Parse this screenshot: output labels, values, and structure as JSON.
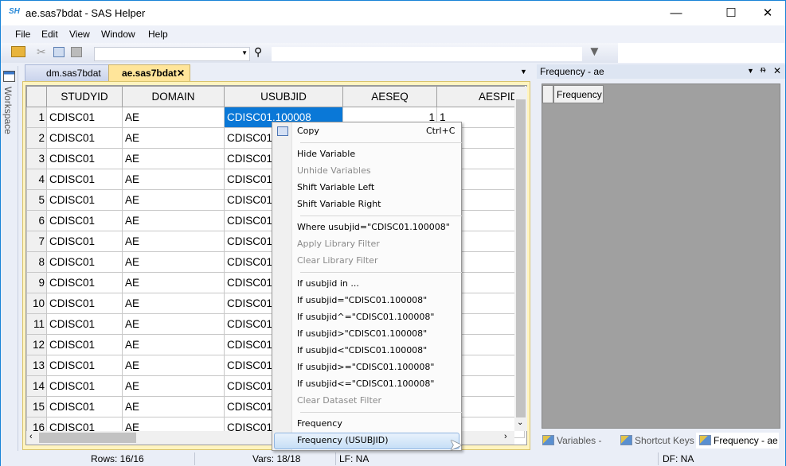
{
  "window": {
    "app_icon": "SH",
    "title": "ae.sas7bdat - SAS Helper",
    "minimize": "—",
    "maximize": "☐",
    "close": "✕"
  },
  "menu": [
    "File",
    "Edit",
    "View",
    "Window",
    "Help"
  ],
  "toolbar": {
    "icons": [
      "open-folder-icon",
      "cut-icon",
      "copy-icon",
      "paste-icon",
      "binoculars-icon",
      "filter-icon"
    ]
  },
  "workspace": {
    "label": "Workspace"
  },
  "doc_tabs": [
    {
      "label": "dm.sas7bdat",
      "active": false
    },
    {
      "label": "ae.sas7bdat",
      "active": true,
      "close": "✕"
    }
  ],
  "grid": {
    "columns": [
      "STUDYID",
      "DOMAIN",
      "USUBJID",
      "AESEQ",
      "AESPID"
    ],
    "rows": [
      [
        "1",
        "CDISC01",
        "AE",
        "CDISC01.100008",
        "1",
        "1"
      ],
      [
        "2",
        "CDISC01",
        "AE",
        "CDISC01.",
        "",
        ""
      ],
      [
        "3",
        "CDISC01",
        "AE",
        "CDISC01.",
        "",
        ""
      ],
      [
        "4",
        "CDISC01",
        "AE",
        "CDISC01.",
        "",
        ""
      ],
      [
        "5",
        "CDISC01",
        "AE",
        "CDISC01.",
        "",
        ""
      ],
      [
        "6",
        "CDISC01",
        "AE",
        "CDISC01.",
        "",
        ""
      ],
      [
        "7",
        "CDISC01",
        "AE",
        "CDISC01.",
        "",
        ""
      ],
      [
        "8",
        "CDISC01",
        "AE",
        "CDISC01.",
        "",
        ""
      ],
      [
        "9",
        "CDISC01",
        "AE",
        "CDISC01.",
        "",
        ""
      ],
      [
        "10",
        "CDISC01",
        "AE",
        "CDISC01.",
        "",
        ""
      ],
      [
        "11",
        "CDISC01",
        "AE",
        "CDISC01.",
        "",
        ""
      ],
      [
        "12",
        "CDISC01",
        "AE",
        "CDISC01.",
        "",
        ""
      ],
      [
        "13",
        "CDISC01",
        "AE",
        "CDISC01.",
        "",
        ""
      ],
      [
        "14",
        "CDISC01",
        "AE",
        "CDISC01.",
        "",
        ""
      ],
      [
        "15",
        "CDISC01",
        "AE",
        "CDISC01.",
        "",
        ""
      ],
      [
        "16",
        "CDISC01",
        "AE",
        "CDISC01.",
        "",
        ""
      ]
    ],
    "selected_color": "#0a78d7"
  },
  "context_menu": {
    "items": [
      {
        "label": "Copy",
        "shortcut": "Ctrl+C",
        "enabled": true
      },
      {
        "label": "Hide Variable",
        "enabled": true
      },
      {
        "label": "Unhide Variables",
        "enabled": false
      },
      {
        "label": "Shift Variable Left",
        "enabled": true
      },
      {
        "label": "Shift Variable Right",
        "enabled": true
      },
      {
        "label": "Where usubjid=\"CDISC01.100008\"",
        "enabled": true
      },
      {
        "label": "Apply Library Filter",
        "enabled": false
      },
      {
        "label": "Clear Library Filter",
        "enabled": false
      },
      {
        "label": "If usubjid in  ...",
        "enabled": true
      },
      {
        "label": "If usubjid=\"CDISC01.100008\"",
        "enabled": true
      },
      {
        "label": "If usubjid^=\"CDISC01.100008\"",
        "enabled": true
      },
      {
        "label": "If usubjid>\"CDISC01.100008\"",
        "enabled": true
      },
      {
        "label": "If usubjid<\"CDISC01.100008\"",
        "enabled": true
      },
      {
        "label": "If usubjid>=\"CDISC01.100008\"",
        "enabled": true
      },
      {
        "label": "If usubjid<=\"CDISC01.100008\"",
        "enabled": true
      },
      {
        "label": "Clear Dataset Filter",
        "enabled": false
      },
      {
        "label": "Frequency",
        "enabled": true
      },
      {
        "label": "Frequency (USUBJID)",
        "enabled": true,
        "highlighted": true
      }
    ]
  },
  "right_panel": {
    "title": "Frequency - ae",
    "column": "Frequency",
    "tabs": [
      "Variables - ae",
      "Shortcut Keys",
      "Frequency - ae"
    ],
    "active_tab": "Frequency - ae"
  },
  "status": {
    "rows": "Rows: 16/16",
    "vars": "Vars: 18/18",
    "lf": "LF: NA",
    "df": "DF: NA"
  }
}
